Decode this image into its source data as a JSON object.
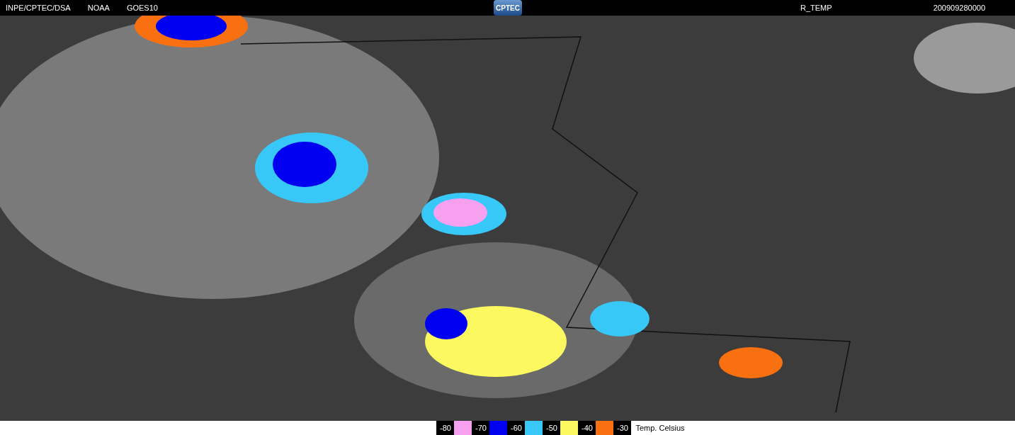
{
  "header": {
    "left_labels": [
      "INPE/CPTEC/DSA",
      "NOAA",
      "GOES10"
    ],
    "logo": "CPTEC",
    "product": "R_TEMP",
    "timestamp": "200909280000"
  },
  "legend": {
    "steps": [
      {
        "label": "-80",
        "color": "#f8a0f0"
      },
      {
        "label": "-70",
        "color": "#0000f0"
      },
      {
        "label": "-60",
        "color": "#38c8f8"
      },
      {
        "label": "-50",
        "color": "#fcf860"
      },
      {
        "label": "-40",
        "color": "#f87010"
      },
      {
        "label": "-30"
      }
    ],
    "unit": "Temp. Celsius"
  }
}
